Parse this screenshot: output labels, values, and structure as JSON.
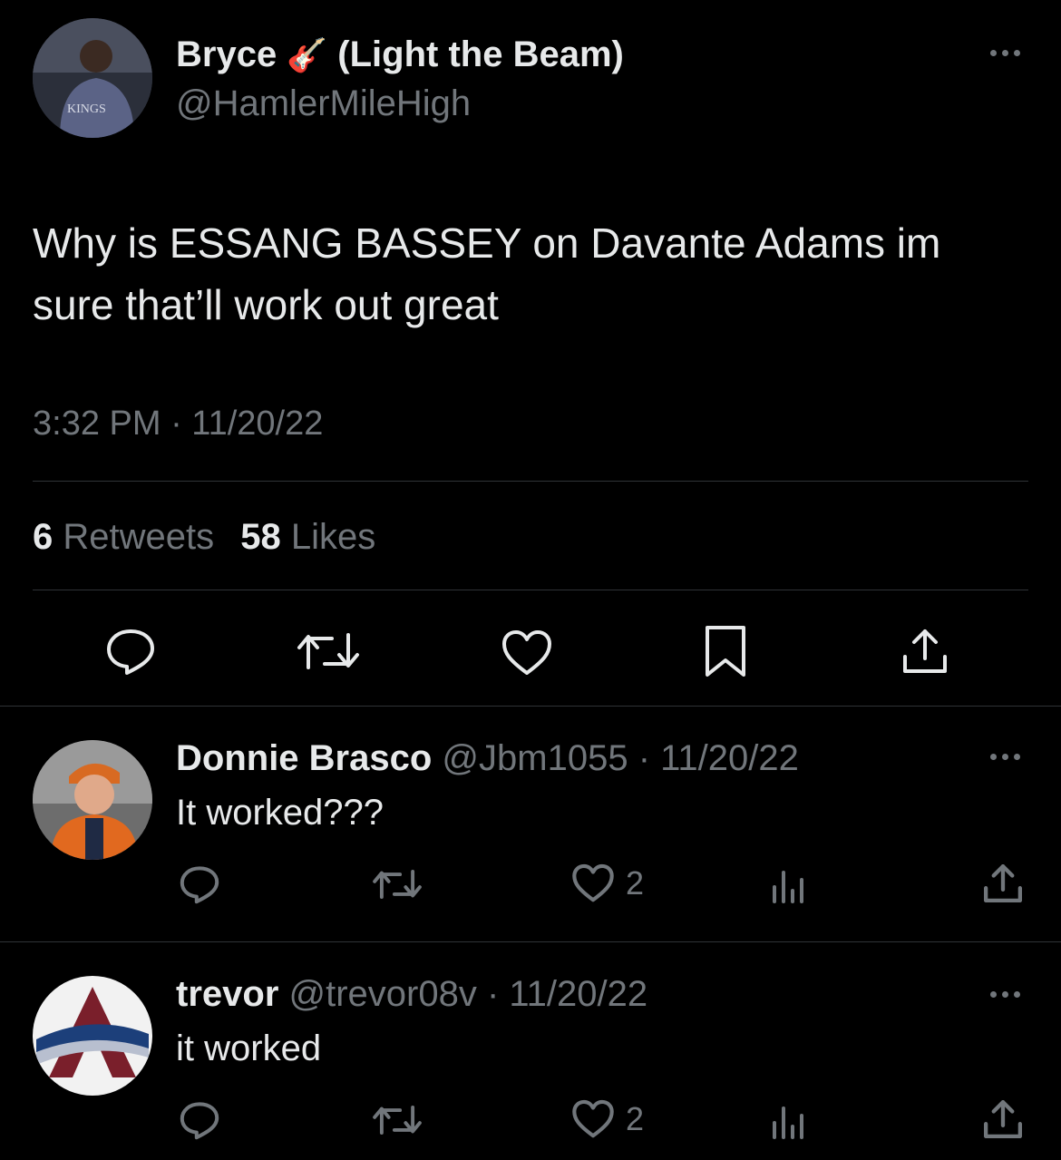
{
  "main_tweet": {
    "author_name": "Bryce",
    "author_emoji": "🎸",
    "author_name_suffix": "(Light the Beam)",
    "handle": "@HamlerMileHigh",
    "avatar_jersey_text": "KINGS",
    "text_line1": "Why is ESSANG BASSEY on Davante Adams im",
    "text_line2": "sure that’ll work out great",
    "timestamp": "3:32 PM · 11/20/22",
    "retweets_count": "6",
    "retweets_label": "Retweets",
    "likes_count": "58",
    "likes_label": "Likes"
  },
  "replies": [
    {
      "author_name": "Donnie Brasco",
      "handle_time": "@Jbm1055 · 11/20/22",
      "text": "It worked???",
      "likes": "2"
    },
    {
      "author_name": "trevor",
      "handle_time": "@trevor08v · 11/20/22",
      "text": "it worked",
      "likes": "2"
    }
  ],
  "icons": {
    "reply": "reply-icon",
    "retweet": "retweet-icon",
    "like": "heart-icon",
    "bookmark": "bookmark-icon",
    "share": "share-icon",
    "views": "views-icon",
    "more": "more-icon"
  },
  "colors": {
    "background": "#000000",
    "text": "#e7e9ea",
    "muted": "#71767b",
    "divider": "#2f3336"
  }
}
